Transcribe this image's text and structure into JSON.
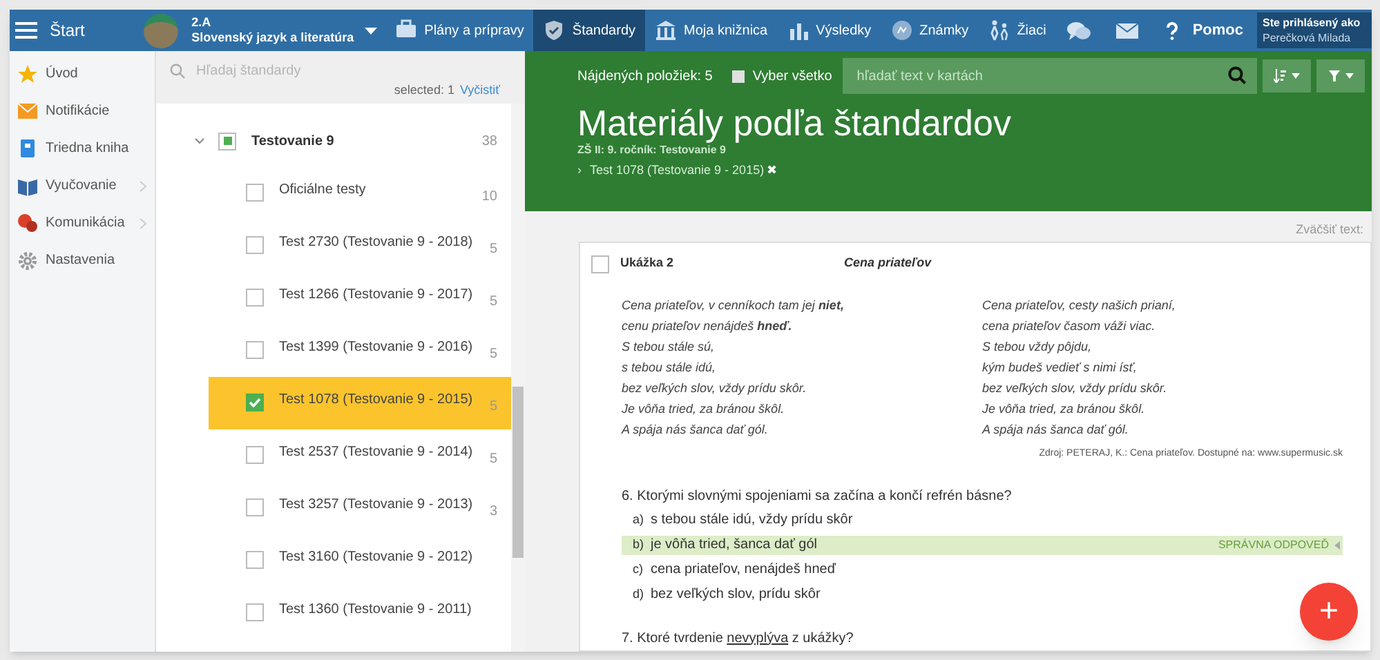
{
  "topbar": {
    "menu_label": "Štart",
    "class_label": "2.A",
    "subject": "Slovenský jazyk a literatúra",
    "nav": [
      {
        "label": "Plány a prípravy",
        "selected": false
      },
      {
        "label": "Štandardy",
        "selected": true
      },
      {
        "label": "Moja knižnica",
        "selected": false
      },
      {
        "label": "Výsledky",
        "selected": false
      },
      {
        "label": "Známky",
        "selected": false
      },
      {
        "label": "Žiaci",
        "selected": false
      }
    ],
    "help_label": "Pomoc",
    "user": {
      "caption": "Ste prihlásený ako",
      "name": "Perečková Milada"
    }
  },
  "sidebar": {
    "items": [
      {
        "label": "Úvod",
        "expandable": false
      },
      {
        "label": "Notifikácie",
        "expandable": false
      },
      {
        "label": "Triedna kniha",
        "expandable": false
      },
      {
        "label": "Vyučovanie",
        "expandable": true
      },
      {
        "label": "Komunikácia",
        "expandable": true
      },
      {
        "label": "Nastavenia",
        "expandable": false
      }
    ]
  },
  "tree": {
    "search": {
      "placeholder": "Hľadaj štandardy"
    },
    "selected_label": "selected: 1",
    "clear_link": "Vyčistiť",
    "root": {
      "label": "Testovanie 9",
      "count": "38",
      "expanded": true,
      "partially_checked": true,
      "children": [
        {
          "label": "Oficiálne testy",
          "count": "10",
          "checked": false,
          "selected": false
        },
        {
          "label": "Test 2730 (Testovanie 9 - 2018)",
          "count": "5",
          "checked": false,
          "selected": false
        },
        {
          "label": "Test 1266 (Testovanie 9 - 2017)",
          "count": "5",
          "checked": false,
          "selected": false
        },
        {
          "label": "Test 1399 (Testovanie 9 - 2016)",
          "count": "5",
          "checked": false,
          "selected": false
        },
        {
          "label": "Test 1078 (Testovanie 9 - 2015)",
          "count": "5",
          "checked": true,
          "selected": true
        },
        {
          "label": "Test 2537 (Testovanie 9 - 2014)",
          "count": "5",
          "checked": false,
          "selected": false
        },
        {
          "label": "Test 3257 (Testovanie 9 - 2013)",
          "count": "3",
          "checked": false,
          "selected": false
        },
        {
          "label": "Test 3160 (Testovanie 9 - 2012)",
          "checked": false,
          "selected": false
        },
        {
          "label": "Test 1360 (Testovanie 9 - 2011)",
          "checked": false,
          "selected": false
        }
      ]
    }
  },
  "main": {
    "found_label": "Nájdených položiek: 5",
    "select_all": {
      "label": "Vyber všetko",
      "checked": false
    },
    "search": {
      "placeholder": "hľadať text v kartách"
    },
    "title": "Materiály podľa štandardov",
    "subtitle": "ZŠ II: 9. ročník: Testovanie 9",
    "breadcrumb": {
      "chevron": "›",
      "label": "Test 1078 (Testovanie 9 - 2015)",
      "remove": "✖"
    },
    "zoom_label": "Zväčšiť text:",
    "card": {
      "checked": false,
      "label": "Ukážka 2",
      "title": "Cena priateľov",
      "poem_columns": [
        [
          "Cena priateľov, v cenníkoch tam jej **niet,**",
          "cenu priateľov nenájdeš **hneď.**",
          "S tebou stále sú,",
          "s tebou stále idú,",
          "bez veľkých slov, vždy prídu skôr.",
          "Je vôňa tried, za bránou škôl.",
          "A spája nás šanca dať gól."
        ],
        [
          "Cena priateľov, cesty našich prianí,",
          "cena priateľov časom váži viac.",
          "S tebou vždy pôjdu,",
          "kým budeš vedieť s nimi ísť,",
          "bez veľkých slov, vždy prídu skôr.",
          "Je vôňa tried, za bránou škôl.",
          "A spája nás šanca dať gól."
        ]
      ],
      "source": "Zdroj: PETERAJ, K.: Cena priateľov. Dostupné na: www.supermusic.sk",
      "correct_label": "SPRÁVNA ODPOVEĎ",
      "questions": [
        {
          "parts": [
            {
              "text": "6. Ktorými slovnými spojeniami sa začína a končí refrén básne?",
              "underline": false
            }
          ],
          "answers": [
            {
              "letter": "a)",
              "text": "s tebou stále idú, vždy prídu skôr",
              "correct": false
            },
            {
              "letter": "b)",
              "text": "je vôňa tried, šanca dať gól",
              "correct": true
            },
            {
              "letter": "c)",
              "text": "cena priateľov, nenájdeš hneď",
              "correct": false
            },
            {
              "letter": "d)",
              "text": "bez veľkých slov, prídu skôr",
              "correct": false
            }
          ]
        },
        {
          "parts": [
            {
              "text": "7. Ktoré tvrdenie ",
              "underline": false
            },
            {
              "text": "nevyplýva",
              "underline": true
            },
            {
              "text": " z ukážky?",
              "underline": false
            }
          ]
        }
      ]
    },
    "fab": "+"
  }
}
